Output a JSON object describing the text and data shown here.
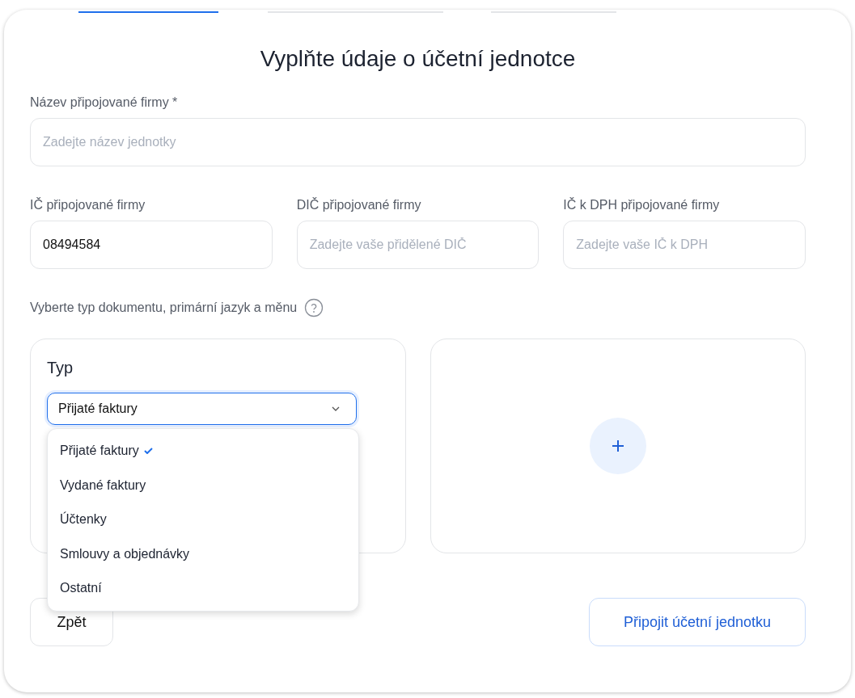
{
  "steps": [
    {
      "selected": true
    },
    {
      "selected": false
    },
    {
      "selected": false
    }
  ],
  "title": "Vyplňte údaje o účetní jednotce",
  "company_name": {
    "label": "Název připojované firmy *",
    "placeholder": "Zadejte název jednotky"
  },
  "id_fields": [
    {
      "label": "IČ připojované firmy",
      "value": "08494584"
    },
    {
      "label": "DIČ připojované firmy",
      "placeholder": "Zadejte vaše přidělené DIČ"
    },
    {
      "label": "IČ k DPH připojované firmy",
      "placeholder": "Zadejte vaše IČ k DPH"
    }
  ],
  "document_section": {
    "label": "Vyberte typ dokumentu, primární jazyk a měnu"
  },
  "type_panel": {
    "heading": "Typ",
    "select": {
      "value": "Přijaté faktury",
      "expanded": true
    },
    "options": [
      {
        "label": "Přijaté faktury",
        "selected": true
      },
      {
        "label": "Vydané faktury",
        "selected": false
      },
      {
        "label": "Účtenky",
        "selected": false
      },
      {
        "label": "Smlouvy a objednávky",
        "selected": false
      },
      {
        "label": "Ostatní",
        "selected": false
      }
    ]
  },
  "buttons": {
    "back": "Zpět",
    "submit": "Připojit účetní jednotku"
  }
}
